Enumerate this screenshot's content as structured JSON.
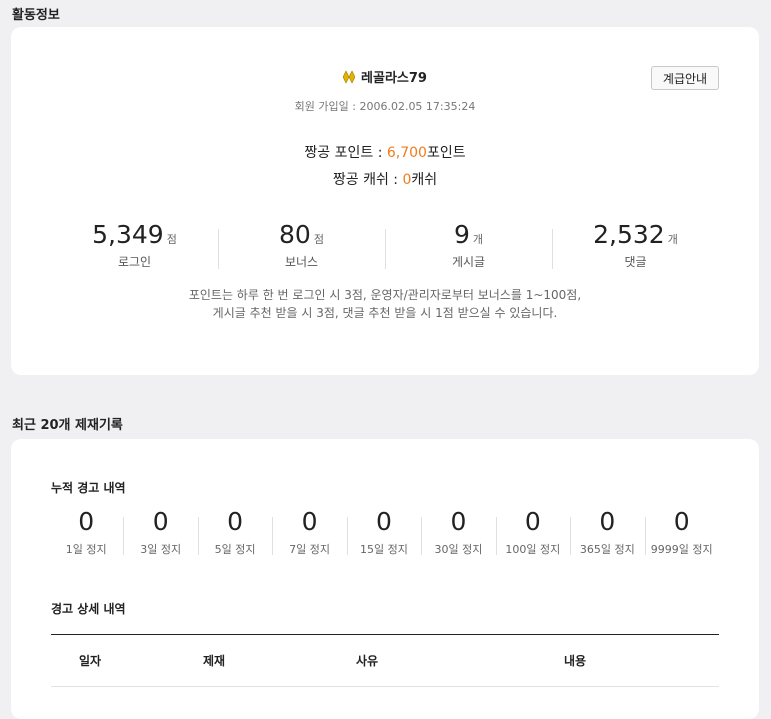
{
  "activity": {
    "title": "활동정보",
    "username": "레골라스79",
    "grade_button": "계급안내",
    "join_label": "회원 가입일 : ",
    "join_date": "2006.02.05 17:35:24",
    "points": {
      "label": "짱공 포인트 : ",
      "value": "6,700",
      "unit": "포인트"
    },
    "cash": {
      "label": "짱공 캐쉬 : ",
      "value": "0",
      "unit": "캐쉬"
    },
    "stats": [
      {
        "value": "5,349",
        "unit": "점",
        "label": "로그인"
      },
      {
        "value": "80",
        "unit": "점",
        "label": "보너스"
      },
      {
        "value": "9",
        "unit": "개",
        "label": "게시글"
      },
      {
        "value": "2,532",
        "unit": "개",
        "label": "댓글"
      }
    ],
    "notice_line1": "포인트는 하루 한 번  로그인 시 3점, 운영자/관리자로부터  보너스를 1~100점,",
    "notice_line2": "게시글 추천 받을 시 3점, 댓글 추천 받을 시 1점 받으실 수 있습니다."
  },
  "sanctions": {
    "title": "최근 20개 제재기록",
    "warn_title": "누적 경고 내역",
    "warnings": [
      {
        "value": "0",
        "label": "1일 정지"
      },
      {
        "value": "0",
        "label": "3일 정지"
      },
      {
        "value": "0",
        "label": "5일 정지"
      },
      {
        "value": "0",
        "label": "7일 정지"
      },
      {
        "value": "0",
        "label": "15일 정지"
      },
      {
        "value": "0",
        "label": "30일 정지"
      },
      {
        "value": "0",
        "label": "100일 정지"
      },
      {
        "value": "0",
        "label": "365일 정지"
      },
      {
        "value": "0",
        "label": "9999일 정지"
      }
    ],
    "detail_title": "경고 상세 내역",
    "columns": [
      "일자",
      "제재",
      "사유",
      "내용"
    ]
  },
  "colors": {
    "accent": "#f07c1c",
    "grade_icon": "#e2b400"
  }
}
